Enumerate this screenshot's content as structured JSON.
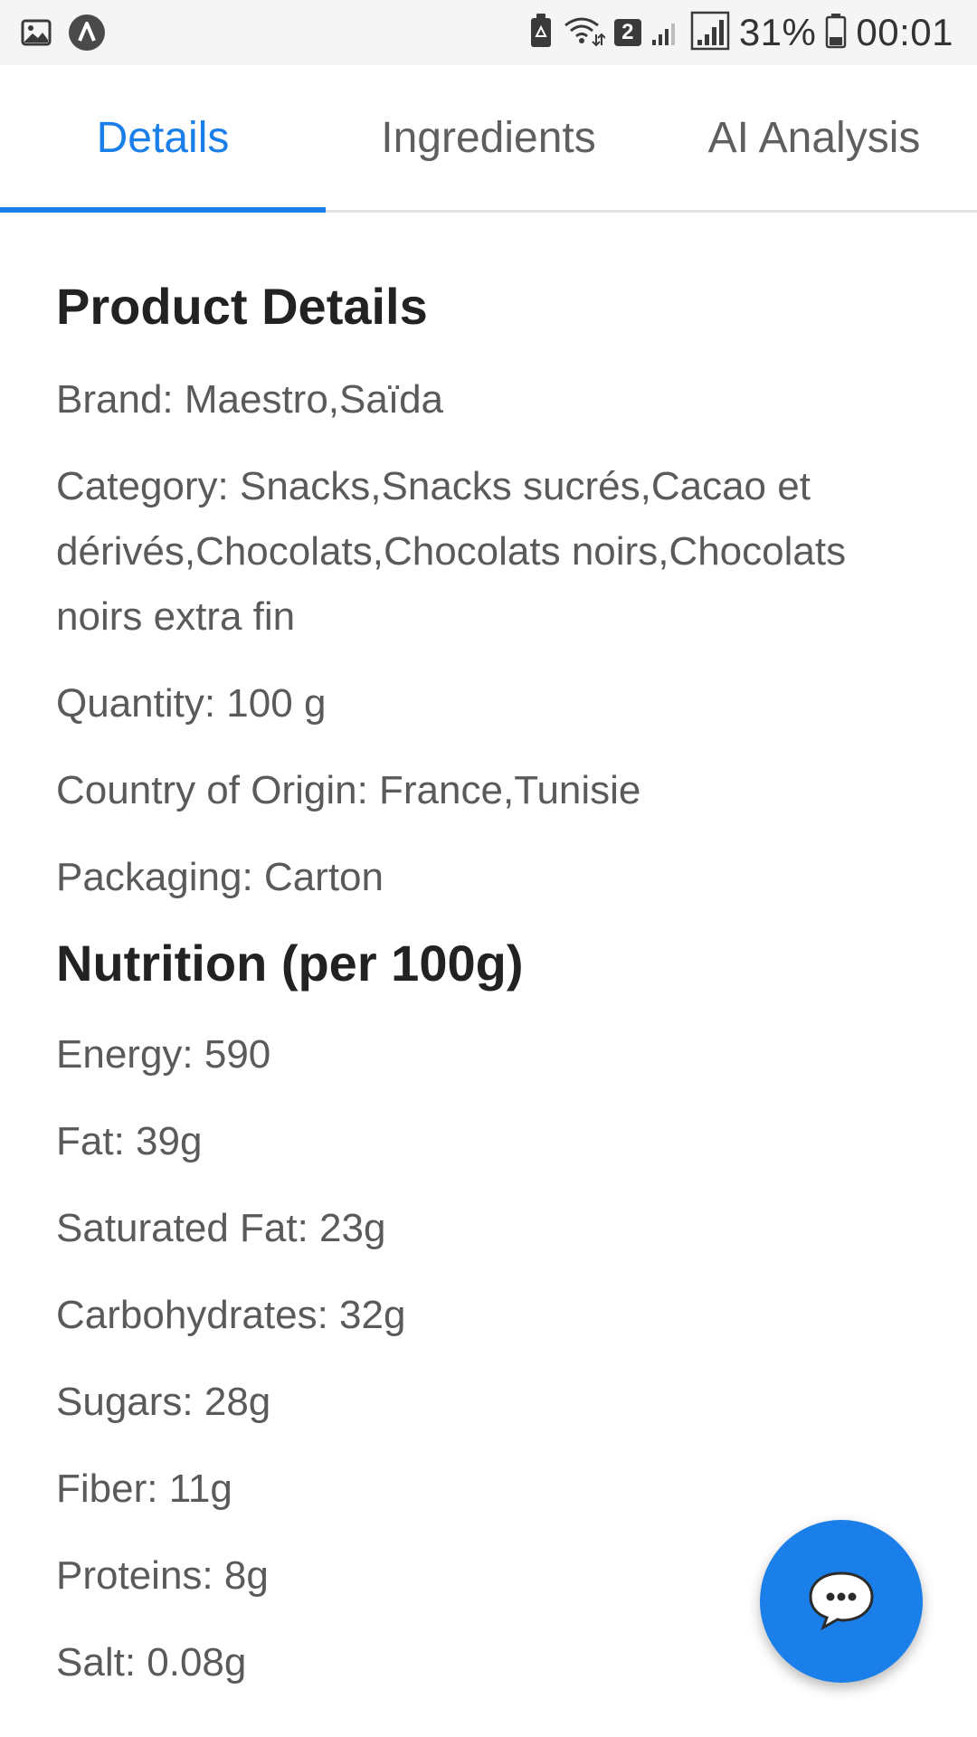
{
  "status_bar": {
    "icons_left": [
      "image-icon",
      "app-logo-icon"
    ],
    "icons_right": [
      "clean-battery-icon",
      "wifi-icon",
      "sim-2-signal-icon",
      "cell-signal-icon"
    ],
    "sim_badge": "2",
    "battery_percent": "31%",
    "time": "00:01"
  },
  "tabs": [
    {
      "label": "Details",
      "active": true
    },
    {
      "label": "Ingredients",
      "active": false
    },
    {
      "label": "AI Analysis",
      "active": false
    }
  ],
  "product_details": {
    "title": "Product Details",
    "brand": "Brand: Maestro,Saïda",
    "category": "Category: Snacks,Snacks sucrés,Cacao et dérivés,Chocolats,Chocolats noirs,Chocolats noirs extra fin",
    "quantity": "Quantity: 100 g",
    "country": "Country of Origin: France,Tunisie",
    "packaging": "Packaging: Carton"
  },
  "nutrition": {
    "title": "Nutrition (per 100g)",
    "energy": "Energy: 590",
    "fat": "Fat: 39g",
    "saturated_fat": "Saturated Fat: 23g",
    "carbohydrates": "Carbohydrates: 32g",
    "sugars": "Sugars: 28g",
    "fiber": "Fiber: 11g",
    "proteins": "Proteins: 8g",
    "salt": "Salt: 0.08g"
  },
  "fab": {
    "icon": "chat-bubble-icon"
  },
  "colors": {
    "accent": "#1a7fe8",
    "text_primary": "#222222",
    "text_secondary": "#5a5a5a",
    "status_bar_bg": "#f5f5f5"
  }
}
